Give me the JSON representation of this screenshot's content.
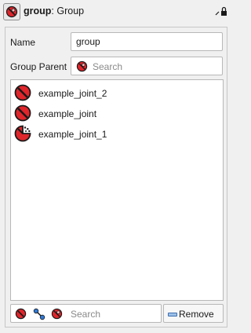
{
  "header": {
    "title_bold": "group",
    "title_rest": ": Group",
    "title_icon": "group-icon",
    "lock_icon": "lock-icon"
  },
  "form": {
    "name_label": "Name",
    "name_value": "group",
    "parent_label": "Group Parent",
    "parent_placeholder": "Search"
  },
  "members": [
    {
      "label": "example_joint_2",
      "icon": "joint-icon"
    },
    {
      "label": "example_joint",
      "icon": "joint-icon"
    },
    {
      "label": "example_joint_1",
      "icon": "rotational-joint-icon"
    }
  ],
  "footer": {
    "search_placeholder": "Search",
    "remove_label": "Remove",
    "filter_icons": [
      "joint-filter-icon",
      "link-filter-icon",
      "group-filter-icon"
    ]
  },
  "colors": {
    "icon_red": "#e0252b",
    "icon_dark": "#1a1a1a",
    "link_blue": "#2f79d6",
    "background": "#f0f0f0"
  }
}
